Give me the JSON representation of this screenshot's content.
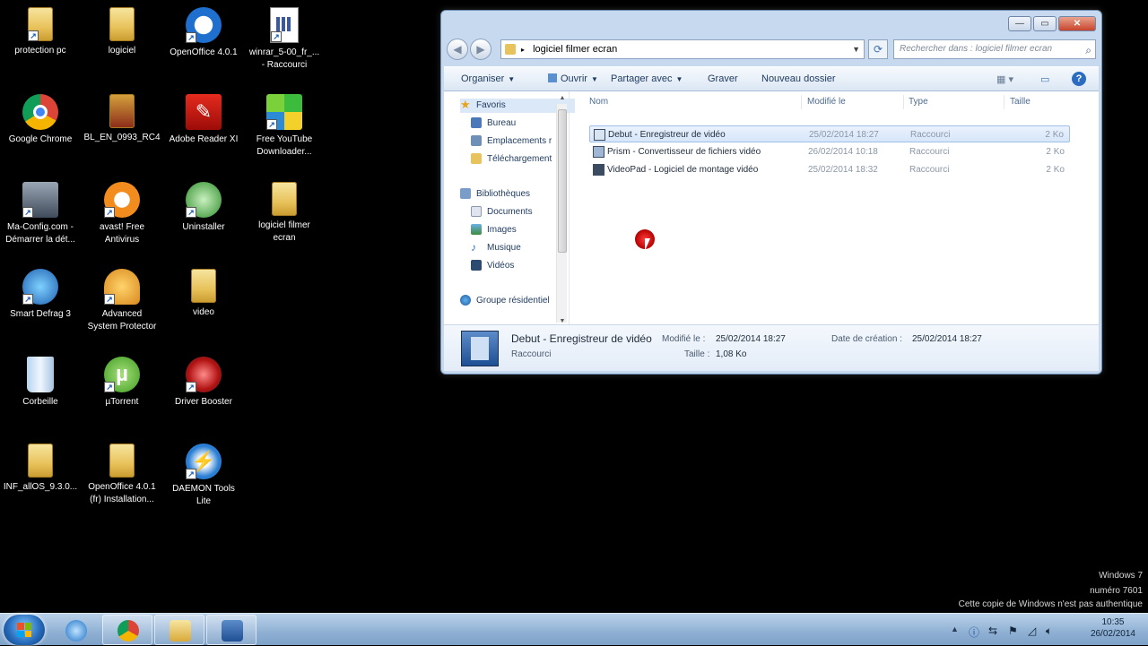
{
  "desktop": {
    "icons": [
      {
        "label": "protection pc"
      },
      {
        "label": "logiciel"
      },
      {
        "label": "OpenOffice 4.0.1"
      },
      {
        "label": "winrar_5-00_fr_...\n- Raccourci"
      },
      {
        "label": "Google Chrome"
      },
      {
        "label": "BL_EN_0993_RC4"
      },
      {
        "label": "Adobe Reader XI"
      },
      {
        "label": "Free YouTube\nDownloader..."
      },
      {
        "label": "Ma-Config.com -\nDémarrer la dét..."
      },
      {
        "label": "avast! Free\nAntivirus"
      },
      {
        "label": "Uninstaller"
      },
      {
        "label": "logiciel filmer\necran"
      },
      {
        "label": "Smart Defrag 3"
      },
      {
        "label": "Advanced\nSystem Protector"
      },
      {
        "label": "video"
      },
      {
        "label": "Corbeille"
      },
      {
        "label": "µTorrent"
      },
      {
        "label": "Driver Booster"
      },
      {
        "label": "INF_allOS_9.3.0..."
      },
      {
        "label": "OpenOffice 4.0.1\n(fr) Installation..."
      },
      {
        "label": "DAEMON Tools\nLite"
      }
    ]
  },
  "window": {
    "title_buttons": {
      "minimize": "—",
      "maximize": "▭",
      "close": "✕"
    },
    "address": "logiciel filmer ecran",
    "address_sep": "▸",
    "search_placeholder": "Rechercher dans : logiciel filmer ecran",
    "toolbar": {
      "organize": "Organiser",
      "open": "Ouvrir",
      "share": "Partager avec",
      "burn": "Graver",
      "new_folder": "Nouveau dossier"
    },
    "nav": {
      "favorites": "Favoris",
      "items": [
        "Bureau",
        "Emplacements r",
        "Téléchargement"
      ],
      "libraries": "Bibliothèques",
      "lib_items": [
        "Documents",
        "Images",
        "Musique",
        "Vidéos"
      ],
      "homegroup": "Groupe résidentiel"
    },
    "columns": {
      "name": "Nom",
      "modified": "Modifié le",
      "type": "Type",
      "size": "Taille"
    },
    "files": [
      {
        "name": "Debut - Enregistreur de vidéo",
        "modified": "25/02/2014 18:27",
        "type": "Raccourci",
        "size": "2 Ko"
      },
      {
        "name": "Prism - Convertisseur de fichiers vidéo",
        "modified": "26/02/2014 10:18",
        "type": "Raccourci",
        "size": "2 Ko"
      },
      {
        "name": "VideoPad - Logiciel de montage vidéo",
        "modified": "25/02/2014 18:32",
        "type": "Raccourci",
        "size": "2 Ko"
      }
    ],
    "details": {
      "name": "Debut - Enregistreur de vidéo",
      "type": "Raccourci",
      "modified_label": "Modifié le :",
      "modified": "25/02/2014 18:27",
      "size_label": "Taille :",
      "size": "1,08 Ko",
      "created_label": "Date de création :",
      "created": "25/02/2014 18:27"
    }
  },
  "watermark": {
    "line1": "Windows 7",
    "line2": "numéro 7601",
    "line3": "Cette copie de Windows n'est pas authentique"
  },
  "taskbar": {
    "time": "10:35",
    "date": "26/02/2014"
  },
  "colors": {
    "accent": "#3a6fb0",
    "selection": "#d7e6f9",
    "taskbar": "#8fb0d3"
  }
}
